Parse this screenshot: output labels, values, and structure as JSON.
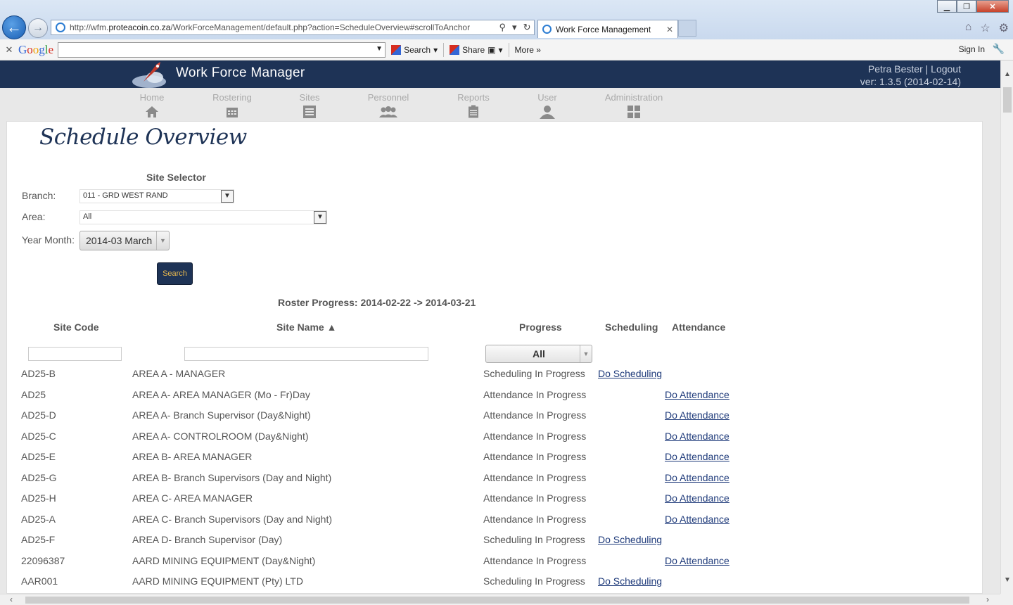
{
  "browser": {
    "url_prefix": "http://wfm.",
    "url_domain": "proteacoin.co.za",
    "url_rest": "/WorkForceManagement/default.php?action=ScheduleOverview#scrollToAnchor",
    "tab_title": "Work Force Management",
    "google": {
      "search_label": "Search",
      "share_label": "Share",
      "more_label": "More »",
      "signin_label": "Sign In"
    }
  },
  "app": {
    "title": "Work Force Manager",
    "user_line": "Petra Bester | Logout",
    "version_line": "ver: 1.3.5 (2014-02-14)"
  },
  "nav": [
    {
      "label": "Home",
      "icon": "home-icon"
    },
    {
      "label": "Rostering",
      "icon": "calendar-icon"
    },
    {
      "label": "Sites",
      "icon": "sites-icon"
    },
    {
      "label": "Personnel",
      "icon": "people-icon"
    },
    {
      "label": "Reports",
      "icon": "clipboard-icon"
    },
    {
      "label": "User",
      "icon": "user-icon"
    },
    {
      "label": "Administration",
      "icon": "grid-icon"
    }
  ],
  "page": {
    "title": "Schedule Overview",
    "site_selector": "Site Selector",
    "branch_label": "Branch:",
    "branch_value": "011 - GRD WEST RAND",
    "area_label": "Area:",
    "area_value": "All",
    "year_month_label": "Year Month:",
    "year_month_value": "2014-03 March",
    "search_button": "Search",
    "roster_progress": "Roster Progress: 2014-02-22 -> 2014-03-21"
  },
  "table": {
    "headers": {
      "site_code": "Site Code",
      "site_name": "Site Name ▲",
      "progress": "Progress",
      "scheduling": "Scheduling",
      "attendance": "Attendance"
    },
    "progress_filter": "All",
    "rows": [
      {
        "code": "AD25-B",
        "name": "AREA A - MANAGER",
        "progress": "Scheduling In Progress",
        "scheduling": "Do Scheduling",
        "attendance": ""
      },
      {
        "code": "AD25",
        "name": "AREA A- AREA MANAGER (Mo - Fr)Day",
        "progress": "Attendance In Progress",
        "scheduling": "",
        "attendance": "Do Attendance"
      },
      {
        "code": "AD25-D",
        "name": "AREA A- Branch Supervisor (Day&Night)",
        "progress": "Attendance In Progress",
        "scheduling": "",
        "attendance": "Do Attendance"
      },
      {
        "code": "AD25-C",
        "name": "AREA A- CONTROLROOM (Day&Night)",
        "progress": "Attendance In Progress",
        "scheduling": "",
        "attendance": "Do Attendance"
      },
      {
        "code": "AD25-E",
        "name": "AREA B- AREA MANAGER",
        "progress": "Attendance In Progress",
        "scheduling": "",
        "attendance": "Do Attendance"
      },
      {
        "code": "AD25-G",
        "name": "AREA B- Branch Supervisors (Day and Night)",
        "progress": "Attendance In Progress",
        "scheduling": "",
        "attendance": "Do Attendance"
      },
      {
        "code": "AD25-H",
        "name": "AREA C- AREA MANAGER",
        "progress": "Attendance In Progress",
        "scheduling": "",
        "attendance": "Do Attendance"
      },
      {
        "code": "AD25-A",
        "name": "AREA C- Branch Supervisors (Day and Night)",
        "progress": "Attendance In Progress",
        "scheduling": "",
        "attendance": "Do Attendance"
      },
      {
        "code": "AD25-F",
        "name": "AREA D- Branch Supervisor (Day)",
        "progress": "Scheduling In Progress",
        "scheduling": "Do Scheduling",
        "attendance": ""
      },
      {
        "code": "22096387",
        "name": "AARD MINING EQUIPMENT (Day&Night)",
        "progress": "Attendance In Progress",
        "scheduling": "",
        "attendance": "Do Attendance"
      },
      {
        "code": "AAR001",
        "name": "AARD MINING EQUIPMENT (Pty) LTD",
        "progress": "Scheduling In Progress",
        "scheduling": "Do Scheduling",
        "attendance": ""
      }
    ]
  },
  "colors": {
    "header_bg": "#1e3356",
    "link": "#1e3a7a",
    "search_btn_text": "#e8b84d"
  }
}
